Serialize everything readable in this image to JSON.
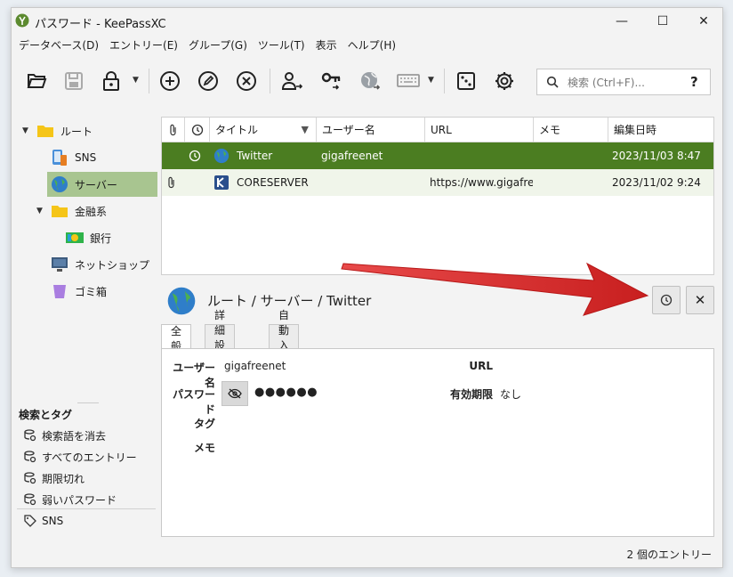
{
  "window": {
    "title": "パスワード - KeePassXC",
    "controls": {
      "minimize": "—",
      "maximize": "☐",
      "close": "✕"
    }
  },
  "menubar": {
    "items": [
      "データベース(D)",
      "エントリー(E)",
      "グループ(G)",
      "ツール(T)",
      "表示",
      "ヘルプ(H)"
    ]
  },
  "toolbar": {
    "buttons": [
      "open-database-icon",
      "save-database-icon",
      "lock-database-icon",
      "add-entry-icon",
      "edit-entry-icon",
      "delete-entry-icon",
      "copy-username-icon",
      "copy-password-icon",
      "copy-url-icon",
      "autotype-icon",
      "password-generator-icon",
      "settings-icon"
    ],
    "search": {
      "placeholder": "検索 (Ctrl+F)...",
      "value": "",
      "help": "?"
    }
  },
  "sidebar": {
    "groups": [
      {
        "label": "ルート",
        "icon": "folder-icon",
        "expanded": true
      },
      {
        "label": "SNS",
        "icon": "devices-icon"
      },
      {
        "label": "サーバー",
        "icon": "globe-icon",
        "selected": true
      },
      {
        "label": "金融系",
        "icon": "folder-icon",
        "expanded": true
      },
      {
        "label": "銀行",
        "icon": "money-icon"
      },
      {
        "label": "ネットショップ",
        "icon": "monitor-icon"
      },
      {
        "label": "ゴミ箱",
        "icon": "trash-icon"
      }
    ],
    "search_section": {
      "title": "検索とタグ",
      "items": [
        "検索語を消去",
        "すべてのエントリー",
        "期限切れ",
        "弱いパスワード"
      ],
      "tags": [
        "SNS"
      ]
    }
  },
  "entries": {
    "columns": [
      "",
      "",
      "タイトル",
      "ユーザー名",
      "URL",
      "メモ",
      "編集日時"
    ],
    "sort_indicator": "▼",
    "rows": [
      {
        "attachment": "",
        "expires": "clock-icon",
        "icon": "globe-icon",
        "title": "Twitter",
        "username": "gigafreenet",
        "url": "",
        "notes": "",
        "modified": "2023/11/03 8:47",
        "selected": true
      },
      {
        "attachment": "paperclip-icon",
        "expires": "",
        "icon": "coreserver-icon",
        "title": "CORESERVER",
        "username": "",
        "url": "https://www.gigafre...",
        "notes": "",
        "modified": "2023/11/02 9:24",
        "selected": false
      }
    ]
  },
  "detail": {
    "breadcrumb": "ルート / サーバー / Twitter",
    "tabs": [
      "全般",
      "詳細設定",
      "自動入力"
    ],
    "active_tab": 0,
    "fields": {
      "username_label": "ユーザー名",
      "username_value": "gigafreenet",
      "password_label": "パスワード",
      "password_value": "●●●●●●",
      "tags_label": "タグ",
      "notes_label": "メモ",
      "url_label": "URL",
      "url_value": "",
      "expires_label": "有効期限",
      "expires_value": "なし"
    }
  },
  "status": {
    "entry_count": "2 個のエントリー"
  },
  "colors": {
    "selected_row": "#4b7d21",
    "selected_group": "#a8c590",
    "annotation_arrow": "#d42a2a"
  }
}
